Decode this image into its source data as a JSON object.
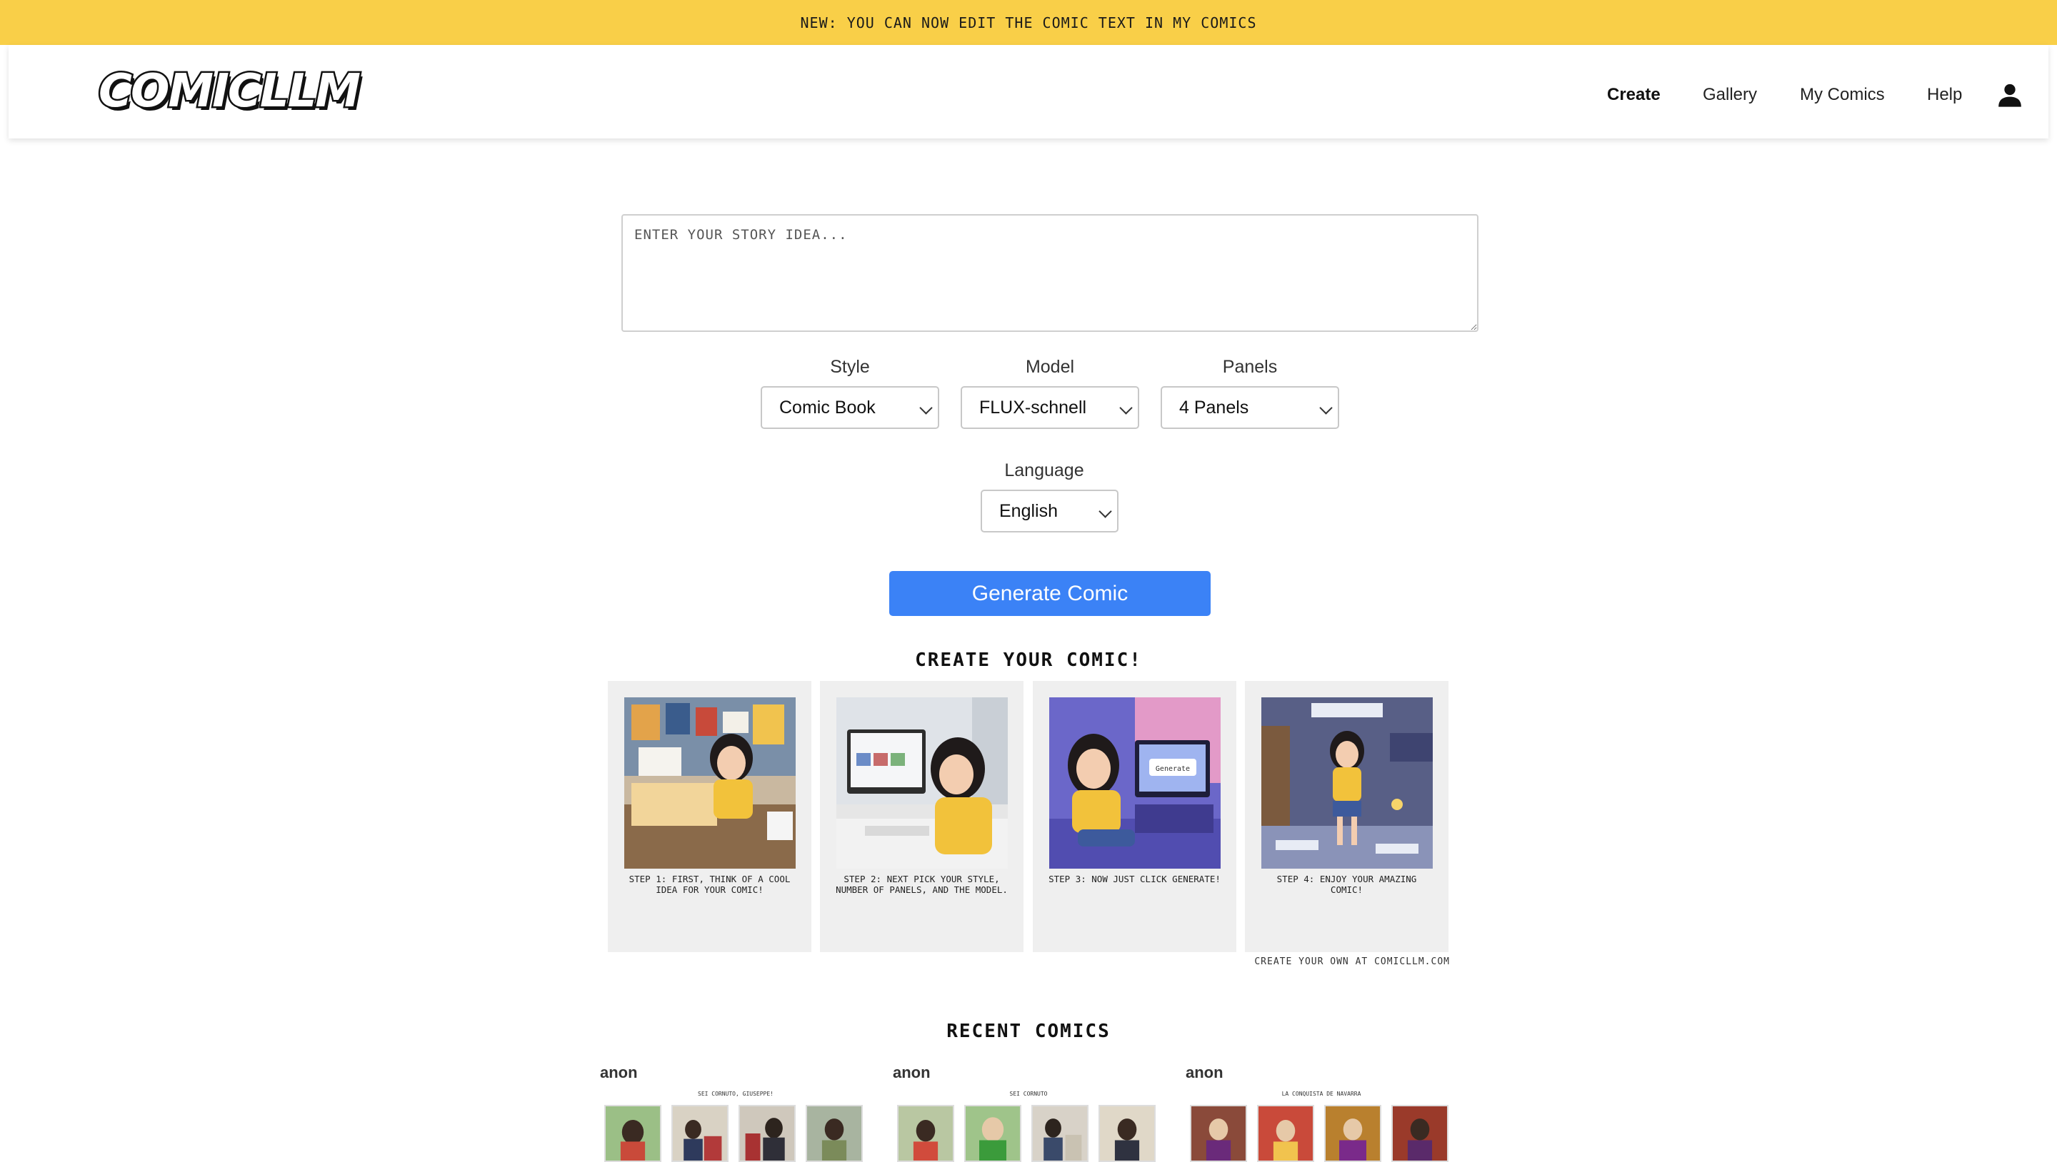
{
  "banner": {
    "text": "NEW: YOU CAN NOW EDIT THE COMIC TEXT IN MY COMICS"
  },
  "header": {
    "logo": "COMICLLM",
    "nav": [
      {
        "label": "Create",
        "active": true
      },
      {
        "label": "Gallery",
        "active": false
      },
      {
        "label": "My Comics",
        "active": false
      },
      {
        "label": "Help",
        "active": false
      }
    ],
    "user_icon": "person-icon"
  },
  "form": {
    "story_placeholder": "ENTER YOUR STORY IDEA...",
    "style": {
      "label": "Style",
      "value": "Comic Book"
    },
    "model": {
      "label": "Model",
      "value": "FLUX-schnell"
    },
    "panels": {
      "label": "Panels",
      "value": "4 Panels"
    },
    "language": {
      "label": "Language",
      "value": "English"
    },
    "generate_label": "Generate Comic"
  },
  "howto": {
    "heading": "CREATE YOUR COMIC!",
    "steps": [
      {
        "caption": "STEP 1: FIRST, THINK OF A COOL IDEA FOR YOUR COMIC!"
      },
      {
        "caption": "STEP 2: NEXT PICK YOUR STYLE, NUMBER OF PANELS, AND THE MODEL."
      },
      {
        "caption": "STEP 3: NOW JUST CLICK GENERATE!"
      },
      {
        "caption": "STEP 4: ENJOY YOUR AMAZING COMIC!"
      }
    ],
    "screen_word": "Generate",
    "credit": "CREATE YOUR OWN AT COMICLLM.COM"
  },
  "recent": {
    "heading": "RECENT COMICS",
    "items": [
      {
        "author": "anon",
        "title": "SEI CORNUTO, GIUSEPPE!"
      },
      {
        "author": "anon",
        "title": "SEI CORNUTO"
      },
      {
        "author": "anon",
        "title": "LA CONQUISTA DE NAVARRA"
      }
    ]
  },
  "colors": {
    "banner": "#f9cf48",
    "primary_button": "#3b82f6"
  }
}
